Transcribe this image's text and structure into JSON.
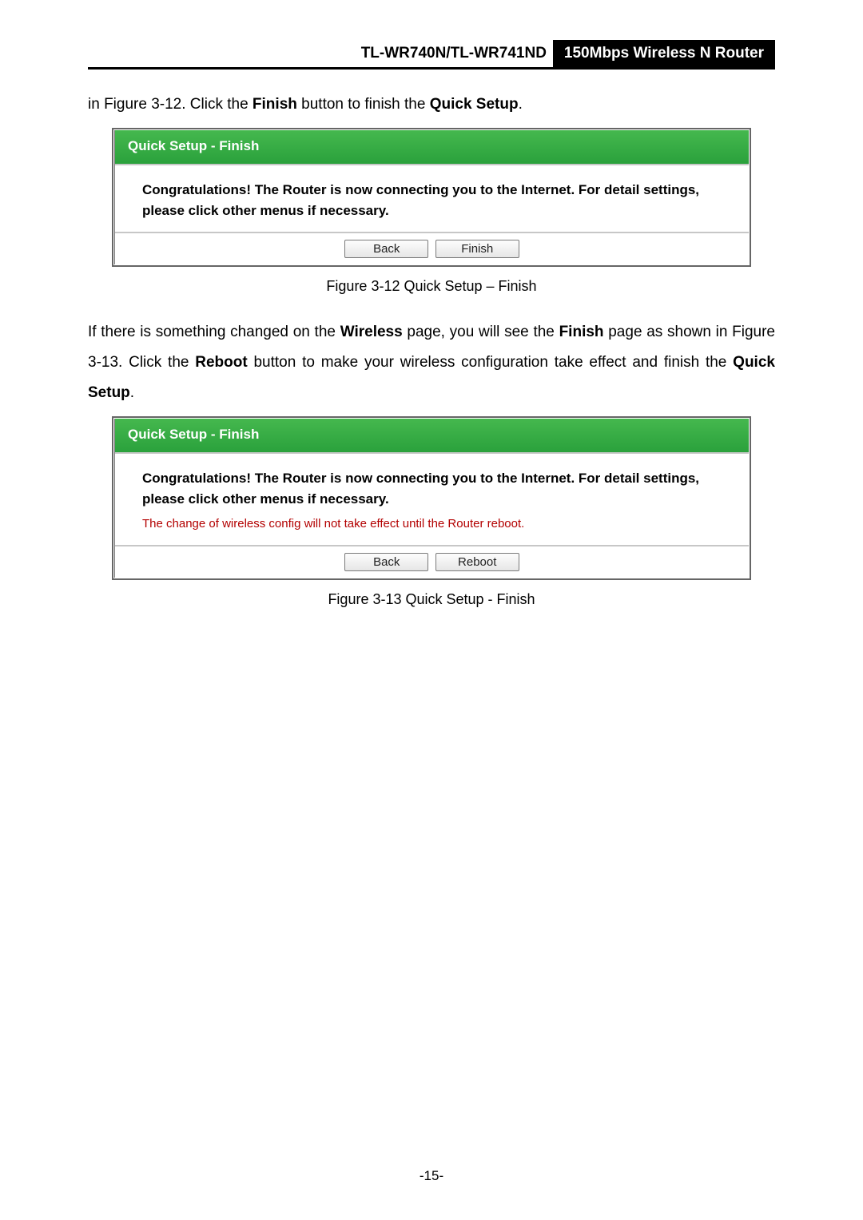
{
  "header": {
    "left": "TL-WR740N/TL-WR741ND",
    "right": "150Mbps Wireless N Router"
  },
  "intro_line": {
    "pre": "in Figure 3-12. Click the ",
    "b1": "Finish",
    "mid": " button to finish the ",
    "b2": "Quick Setup",
    "post": "."
  },
  "panel1": {
    "title": "Quick Setup - Finish",
    "line_b1": "Congratulations!",
    "line_rest": " The Router is now connecting you to the Internet. For detail settings, please click other menus if necessary.",
    "btn_back": "Back",
    "btn_finish": "Finish"
  },
  "caption1": "Figure 3-12    Quick Setup – Finish",
  "para2": {
    "p1a": "If there is something changed on the ",
    "p1b": "Wireless",
    "p1c": " page, you will see the ",
    "p1d": "Finish",
    "p1e": " page as shown in Figure 3-13. Click the ",
    "p1f": "Reboot",
    "p1g": " button to make your wireless configuration take effect and finish the ",
    "p1h": "Quick Setup",
    "p1i": "."
  },
  "panel2": {
    "title": "Quick Setup - Finish",
    "line_b1": "Congratulations!",
    "line_rest": " The Router is now connecting you to the Internet. For detail settings, please click other menus if necessary.",
    "warn": "The change of wireless config will not take effect until the Router reboot.",
    "btn_back": "Back",
    "btn_reboot": "Reboot"
  },
  "caption2": "Figure 3-13    Quick Setup - Finish",
  "page_number": "-15-"
}
